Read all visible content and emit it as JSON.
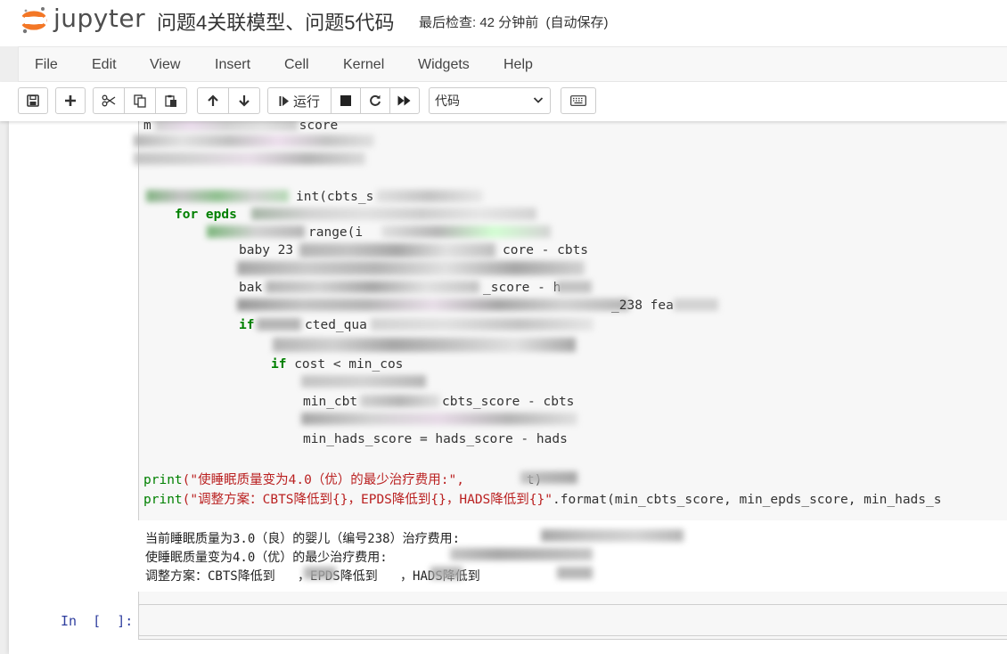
{
  "header": {
    "logo_text": "jupyter",
    "notebook_title": "问题4关联模型、问题5代码",
    "checkpoint_text": "最后检查: 42 分钟前  (自动保存)"
  },
  "menu": [
    "File",
    "Edit",
    "View",
    "Insert",
    "Cell",
    "Kernel",
    "Widgets",
    "Help"
  ],
  "toolbar": {
    "run_label": "运行",
    "cell_type": "代码",
    "icons": [
      "save-icon",
      "add-cell-icon",
      "cut-icon",
      "copy-icon",
      "paste-icon",
      "move-up-icon",
      "move-down-icon",
      "run-icon",
      "interrupt-icon",
      "restart-icon",
      "restart-run-all-icon",
      "keyboard-icon"
    ]
  },
  "code": {
    "visible_fragments": {
      "l1": "score",
      "l5": "int(cbts_s",
      "l6": "for epds",
      "l7": "range(i",
      "l8": "baby 23",
      "l8b": "core - cbts",
      "l10": "_score - h",
      "l11": "_238 fea",
      "l12_kw": "if",
      "l12": "cted_qua",
      "l14_kw": "if",
      "l14": " cost < min_cos",
      "l16a": "min_cbt",
      "l16b": "cbts_score - cbts",
      "l18a": "min_hads_score = hads_score - hads"
    },
    "print1_fn": "print",
    "print1_str": "(\"使睡眠质量变为4.0（优）的最少治疗费用:\",",
    "print1_tail": " t)",
    "print2_fn": "print",
    "print2_str": "(\"调整方案：CBTS降低到{}，EPDS降低到{}，HADS降低到{}\"",
    "print2_tail": ".format(min_cbts_score, min_epds_score, min_hads_s"
  },
  "output": {
    "line1": "当前睡眠质量为3.0（良）的婴儿（编号238）治疗费用:",
    "line2": "使睡眠质量变为4.0（优）的最少治疗费用:",
    "line3a": "调整方案：CBTS降低到",
    "line3b": "，EPDS降低到",
    "line3c": "，HADS降低到"
  },
  "empty_cell": {
    "prompt": "In  [  ]:"
  }
}
